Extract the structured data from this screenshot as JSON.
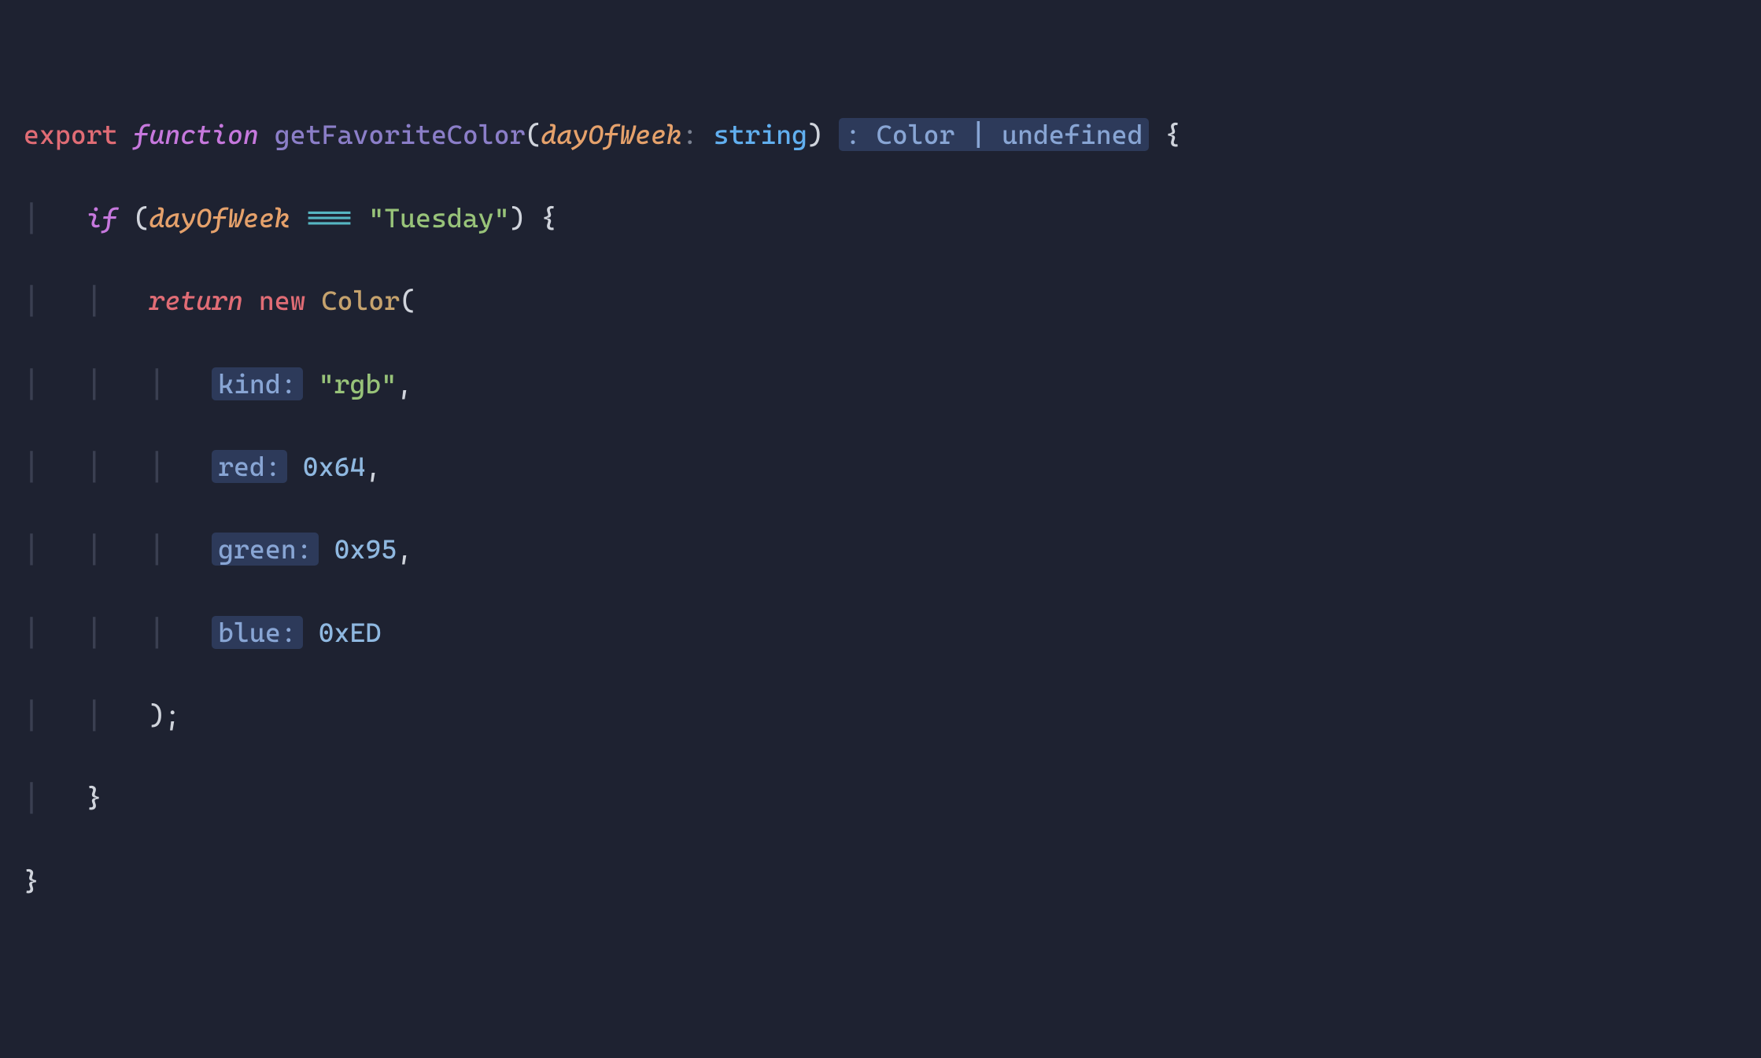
{
  "code": {
    "line1": {
      "export": "export",
      "function": "function",
      "fnName": "getFavoriteColor",
      "lparen": "(",
      "param": "dayOfWeek",
      "colon1": ":",
      "paramType": "string",
      "rparen": ")",
      "hint": ": Color | undefined",
      "lbrace": "{"
    },
    "line2": {
      "if": "if",
      "lparen": "(",
      "var": "dayOfWeek",
      "op": "===",
      "str": "\"Tuesday\"",
      "rparen": ")",
      "lbrace": "{"
    },
    "line3": {
      "return": "return",
      "new": "new",
      "class": "Color",
      "lparen": "("
    },
    "line4": {
      "hint": "kind:",
      "val": "\"rgb\"",
      "comma": ","
    },
    "line5": {
      "hint": "red:",
      "val": "0x64",
      "comma": ","
    },
    "line6": {
      "hint": "green:",
      "val": "0x95",
      "comma": ","
    },
    "line7": {
      "hint": "blue:",
      "val": "0xED"
    },
    "line8": {
      "rparen": ")",
      "semi": ";"
    },
    "line9": {
      "rbrace": "}"
    },
    "line10": {
      "rbrace": "}"
    }
  }
}
